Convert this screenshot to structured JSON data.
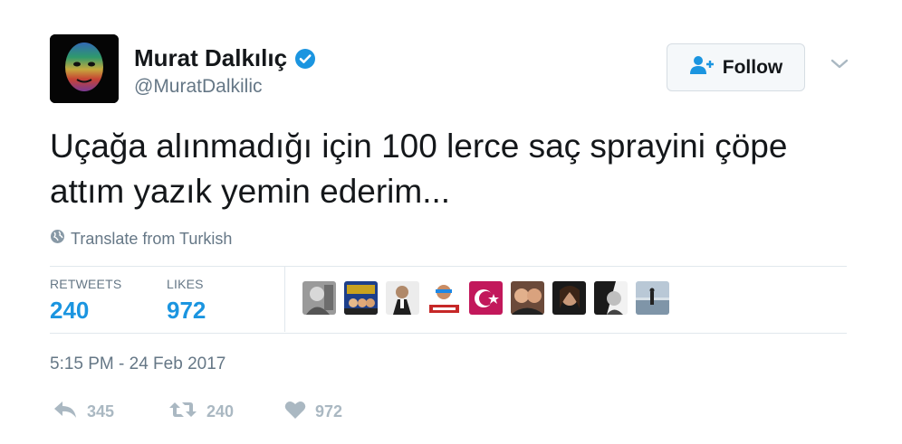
{
  "tweet": {
    "author": {
      "display_name": "Murat Dalkılıç",
      "handle": "@MuratDalkilic",
      "verified": true,
      "avatar_icon": "rainbow-portrait"
    },
    "follow_label": "Follow",
    "text": "Uçağa alınmadığı için 100 lerce saç sprayini çöpe attım yazık yemin ederim...",
    "translate_label": "Translate from Turkish",
    "stats": {
      "retweets_label": "RETWEETS",
      "retweets_value": "240",
      "likes_label": "LIKES",
      "likes_value": "972"
    },
    "likers": [
      {
        "icon": "liker-avatar-1"
      },
      {
        "icon": "liker-avatar-2"
      },
      {
        "icon": "liker-avatar-3"
      },
      {
        "icon": "liker-avatar-4"
      },
      {
        "icon": "liker-avatar-5"
      },
      {
        "icon": "liker-avatar-6"
      },
      {
        "icon": "liker-avatar-7"
      },
      {
        "icon": "liker-avatar-8"
      },
      {
        "icon": "liker-avatar-9"
      }
    ],
    "timestamp": "5:15 PM - 24 Feb 2017",
    "actions": {
      "reply_count": "345",
      "retweet_count": "240",
      "like_count": "972"
    }
  },
  "colors": {
    "accent": "#1b95e0",
    "muted": "#657786",
    "action_grey": "#aab8c2",
    "divider": "#e1e8ed"
  }
}
